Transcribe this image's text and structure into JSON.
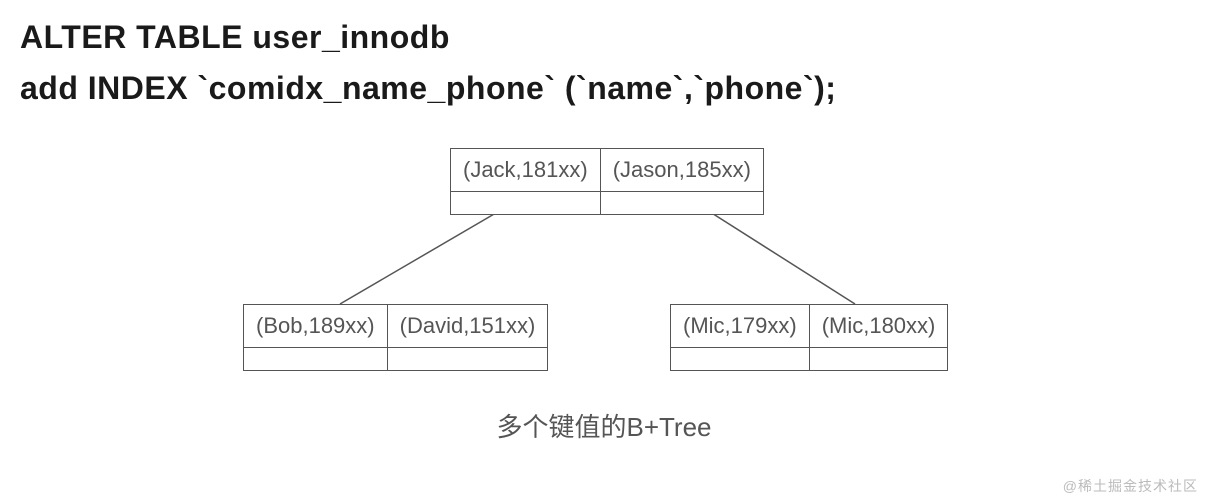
{
  "sql": {
    "line1": "ALTER TABLE user_innodb",
    "line2": "add INDEX `comidx_name_phone` (`name`,`phone`);"
  },
  "tree": {
    "root": {
      "cells": [
        "(Jack,181xx)",
        "(Jason,185xx)"
      ]
    },
    "leaves": [
      {
        "cells": [
          "(Bob,189xx)",
          "(David,151xx)"
        ]
      },
      {
        "cells": [
          "(Mic,179xx)",
          "(Mic,180xx)"
        ]
      }
    ]
  },
  "caption": "多个键值的B+Tree",
  "watermark": "@稀土掘金技术社区"
}
